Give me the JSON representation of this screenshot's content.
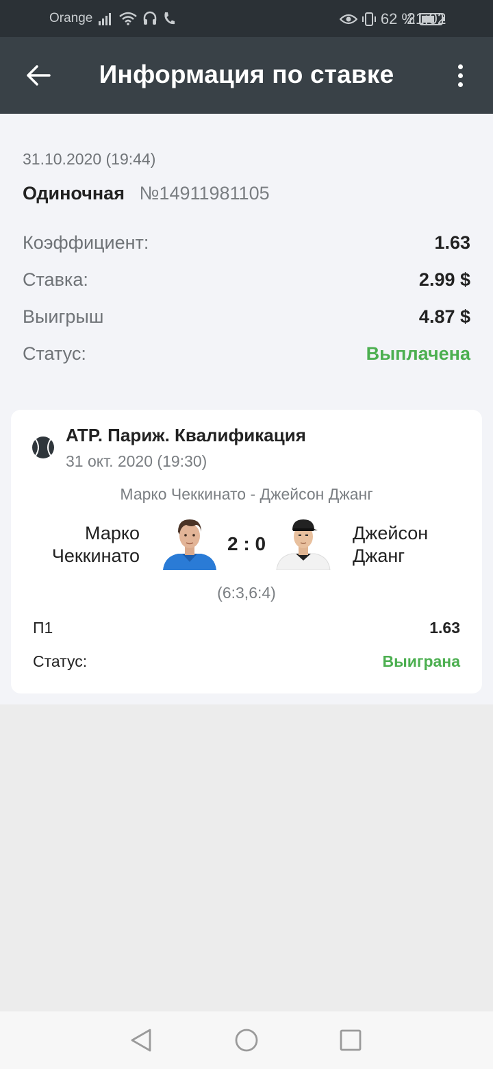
{
  "status_bar": {
    "carrier": "Orange",
    "battery_percent": "62 %",
    "time": "21:02"
  },
  "header": {
    "title": "Информация по ставке",
    "back_icon": "arrow-left-icon",
    "menu_icon": "more-vert-icon"
  },
  "bet": {
    "date": "31.10.2020 (19:44)",
    "type": "Одиночная",
    "number": "№14911981105",
    "rows": [
      {
        "label": "Коэффициент:",
        "value": "1.63"
      },
      {
        "label": "Ставка:",
        "value": "2.99 $"
      },
      {
        "label": "Выигрыш",
        "value": "4.87 $"
      },
      {
        "label": "Статус:",
        "value": "Выплачена"
      }
    ]
  },
  "event": {
    "sport_icon": "tennis-ball-icon",
    "league": "ATP. Париж. Квалификация",
    "date": "31 окт. 2020 (19:30)",
    "match_name": "Марко Чеккинато - Джейсон Джанг",
    "player1": {
      "line1": "Марко",
      "line2": "Чеккинато"
    },
    "player2": {
      "line1": "Джейсон",
      "line2": "Джанг"
    },
    "score": "2 : 0",
    "sets": "(6:3,6:4)",
    "outcome": {
      "label": "П1",
      "value": "1.63"
    },
    "status": {
      "label": "Статус:",
      "value": "Выиграна"
    }
  },
  "colors": {
    "status_bar": "#2b3136",
    "app_bar": "#394147",
    "positive": "#4caf50"
  },
  "navbar": {
    "back_icon": "triangle-back-icon",
    "home_icon": "circle-home-icon",
    "recents_icon": "square-recents-icon"
  }
}
